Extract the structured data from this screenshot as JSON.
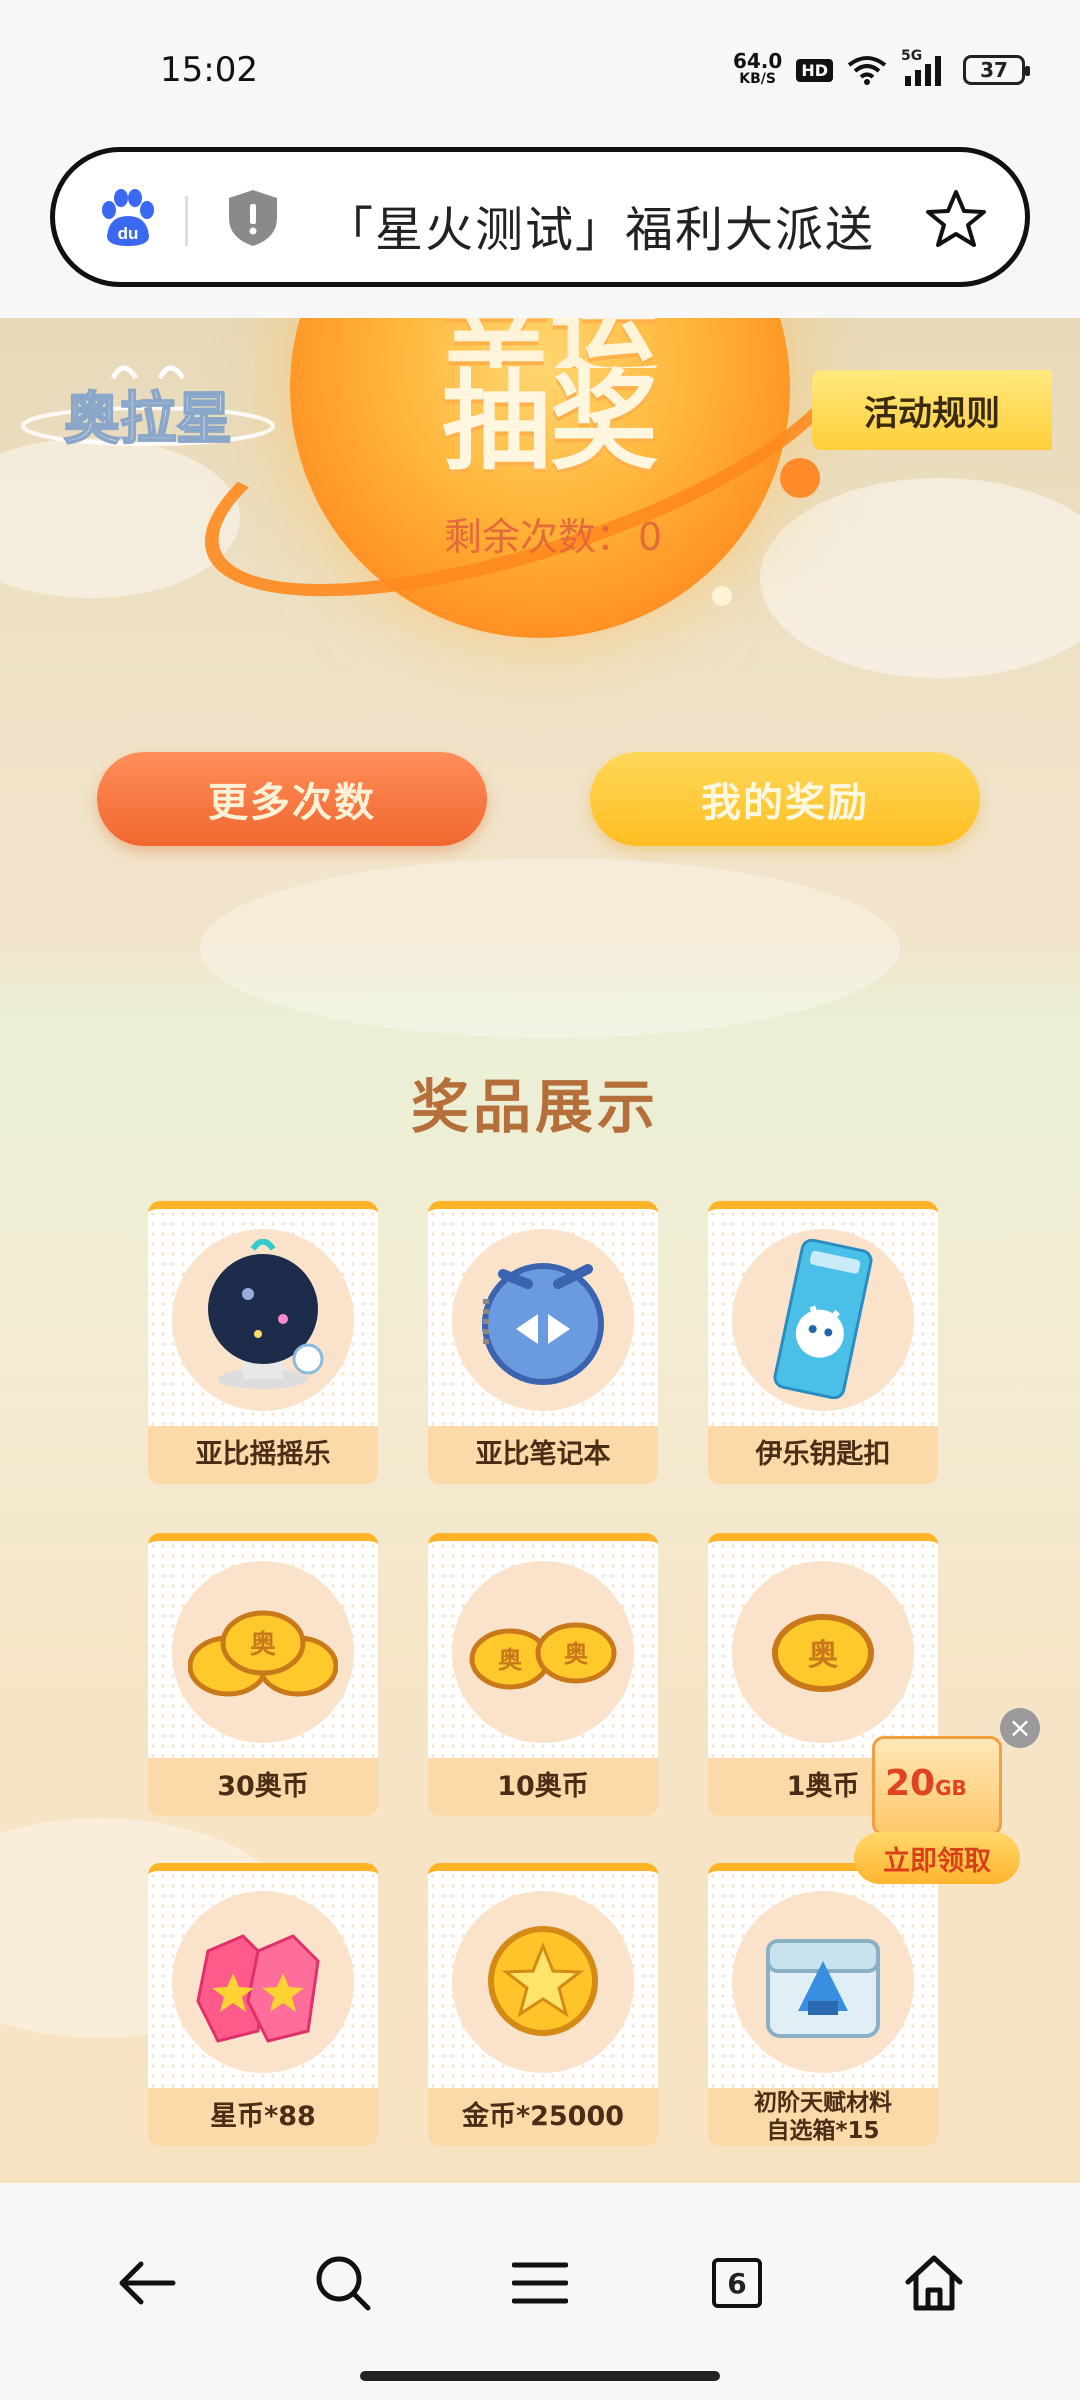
{
  "status_bar": {
    "time": "15:02",
    "net_speed_value": "64.0",
    "net_speed_unit": "KB/S",
    "hd": "HD",
    "network": "5G",
    "battery": "37"
  },
  "url_bar": {
    "title": "「星火测试」福利大派送"
  },
  "hero": {
    "lottery_title": "抽奖",
    "remaining_label": "剩余次数：",
    "remaining_count": "0",
    "rules_button": "活动规则"
  },
  "actions": {
    "more_tries": "更多次数",
    "my_rewards": "我的奖励"
  },
  "prizes": {
    "section_title": "奖品展示",
    "items": [
      {
        "label": "亚比摇摇乐",
        "icon": "snow-globe-icon"
      },
      {
        "label": "亚比笔记本",
        "icon": "notebook-icon"
      },
      {
        "label": "伊乐钥匙扣",
        "icon": "keychain-icon"
      },
      {
        "label": "30奥币",
        "icon": "coins-icon"
      },
      {
        "label": "10奥币",
        "icon": "coins-icon"
      },
      {
        "label": "1奥币",
        "icon": "coin-icon"
      },
      {
        "label": "星币*88",
        "icon": "star-gem-icon"
      },
      {
        "label": "金币*25000",
        "icon": "gold-coin-icon"
      },
      {
        "label": "初阶天赋材料\n自选箱*15",
        "icon": "material-box-icon"
      }
    ]
  },
  "floating_ad": {
    "amount": "20",
    "unit": "GB",
    "action": "立即领取"
  },
  "bottom_nav": {
    "tab_count": "6"
  }
}
